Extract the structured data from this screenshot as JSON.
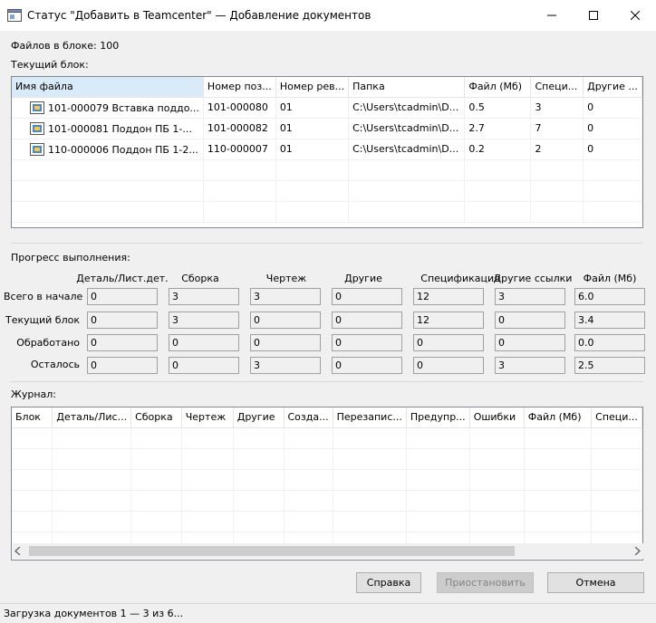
{
  "window": {
    "title": "Статус \"Добавить в Teamcenter\" — Добавление документов",
    "icons": {
      "app": "app-window-icon",
      "minimize": "minimize-icon",
      "maximize": "maximize-icon",
      "close": "close-icon"
    }
  },
  "summary": {
    "files_in_block_label": "Файлов в блоке:",
    "files_in_block_value": "100",
    "current_block_label": "Текущий блок:"
  },
  "files_table": {
    "columns": [
      "Имя файла",
      "Номер поз...",
      "Номер рев...",
      "Папка",
      "Файл (Мб)",
      "Специ...",
      "Другие ..."
    ],
    "rows": [
      [
        "101-000079 Вставка поддо...",
        "101-000080",
        "01",
        "C:\\Users\\tcadmin\\D...",
        "0.5",
        "3",
        "0"
      ],
      [
        "101-000081 Поддон ПБ 1-...",
        "101-000082",
        "01",
        "C:\\Users\\tcadmin\\D...",
        "2.7",
        "7",
        "0"
      ],
      [
        "110-000006 Поддон ПБ 1-2...",
        "110-000007",
        "01",
        "C:\\Users\\tcadmin\\D...",
        "0.2",
        "2",
        "0"
      ]
    ]
  },
  "progress": {
    "label": "Прогресс выполнения:",
    "columns": [
      "Деталь/Лист.дет.",
      "Сборка",
      "Чертеж",
      "Другие",
      "Спецификация",
      "Другие ссылки",
      "Файл (Мб)"
    ],
    "rows": [
      {
        "label": "Всего в начале",
        "values": [
          "0",
          "3",
          "3",
          "0",
          "12",
          "3",
          "6.0"
        ]
      },
      {
        "label": "Текущий блок",
        "values": [
          "0",
          "3",
          "0",
          "0",
          "12",
          "0",
          "3.4"
        ]
      },
      {
        "label": "Обработано",
        "values": [
          "0",
          "0",
          "0",
          "0",
          "0",
          "0",
          "0.0"
        ]
      },
      {
        "label": "Осталось",
        "values": [
          "0",
          "0",
          "3",
          "0",
          "0",
          "3",
          "2.5"
        ]
      }
    ]
  },
  "journal": {
    "label": "Журнал:",
    "columns": [
      "Блок",
      "Деталь/Лис...",
      "Сборка",
      "Чертеж",
      "Другие",
      "Созда...",
      "Перезапис...",
      "Предупр...",
      "Ошибки",
      "Файл (Мб)",
      "Специ..."
    ]
  },
  "buttons": {
    "help": "Справка",
    "pause": "Приостановить",
    "cancel": "Отмена"
  },
  "status": {
    "text": "Загрузка документов 1 — 3 из 6..."
  },
  "colors": {
    "accent_selected_header": "#d9ebf9",
    "window_bg": "#f0f0f0"
  }
}
